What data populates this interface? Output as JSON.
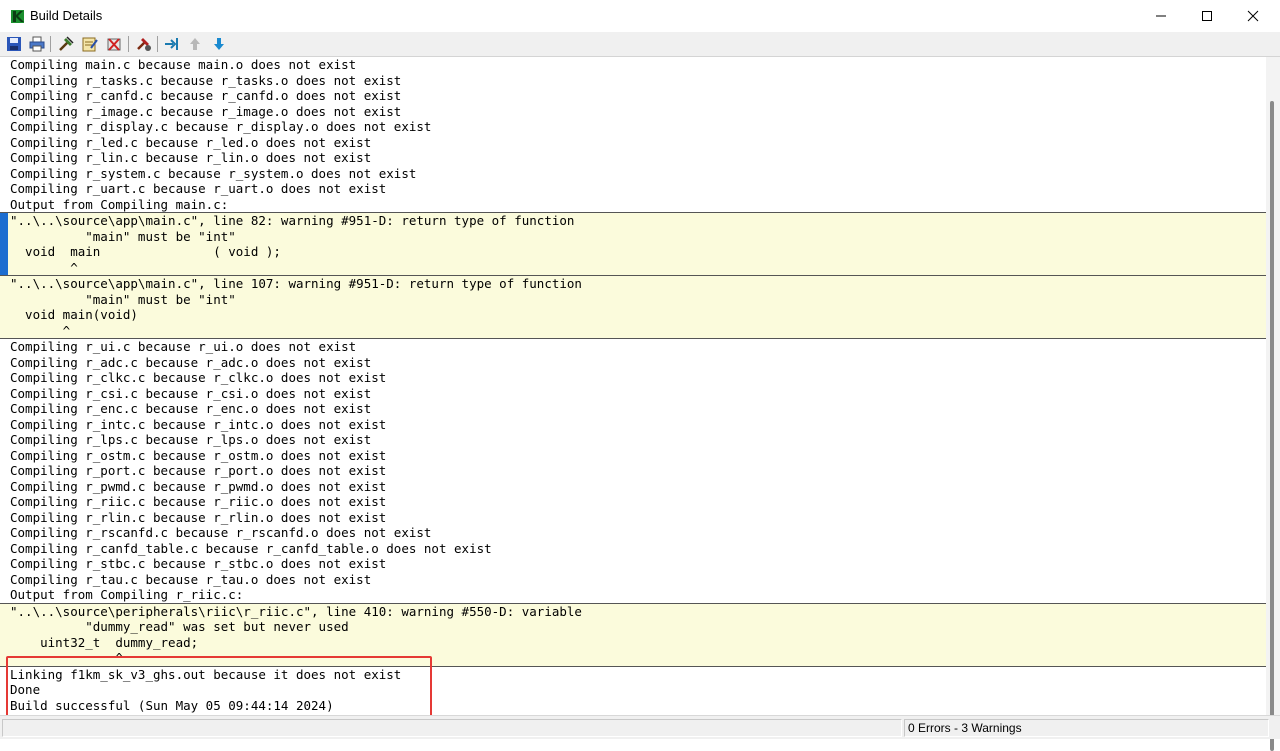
{
  "window": {
    "title": "Build Details"
  },
  "toolbar": {
    "buttons": [
      "save-icon",
      "print-icon",
      "build-icon",
      "edit-icon",
      "clean-icon",
      "settings-icon",
      "goto-icon",
      "prev-error-icon",
      "next-error-icon"
    ]
  },
  "log": {
    "group1": [
      "Compiling main.c because main.o does not exist",
      "Compiling r_tasks.c because r_tasks.o does not exist",
      "Compiling r_canfd.c because r_canfd.o does not exist",
      "Compiling r_image.c because r_image.o does not exist",
      "Compiling r_display.c because r_display.o does not exist",
      "Compiling r_led.c because r_led.o does not exist",
      "Compiling r_lin.c because r_lin.o does not exist",
      "Compiling r_system.c because r_system.o does not exist",
      "Compiling r_uart.c because r_uart.o does not exist",
      "Output from Compiling main.c:"
    ],
    "warning1": [
      "\"..\\..\\source\\app\\main.c\", line 82: warning #951-D: return type of function",
      "          \"main\" must be \"int\"",
      "  void  main               ( void );",
      "        ^"
    ],
    "warning2": [
      "\"..\\..\\source\\app\\main.c\", line 107: warning #951-D: return type of function",
      "          \"main\" must be \"int\"",
      "  void main(void)",
      "       ^"
    ],
    "group2": [
      "Compiling r_ui.c because r_ui.o does not exist",
      "Compiling r_adc.c because r_adc.o does not exist",
      "Compiling r_clkc.c because r_clkc.o does not exist",
      "Compiling r_csi.c because r_csi.o does not exist",
      "Compiling r_enc.c because r_enc.o does not exist",
      "Compiling r_intc.c because r_intc.o does not exist",
      "Compiling r_lps.c because r_lps.o does not exist",
      "Compiling r_ostm.c because r_ostm.o does not exist",
      "Compiling r_port.c because r_port.o does not exist",
      "Compiling r_pwmd.c because r_pwmd.o does not exist",
      "Compiling r_riic.c because r_riic.o does not exist",
      "Compiling r_rlin.c because r_rlin.o does not exist",
      "Compiling r_rscanfd.c because r_rscanfd.o does not exist",
      "Compiling r_canfd_table.c because r_canfd_table.o does not exist",
      "Compiling r_stbc.c because r_stbc.o does not exist",
      "Compiling r_tau.c because r_tau.o does not exist",
      "Output from Compiling r_riic.c:"
    ],
    "warning3": [
      "\"..\\..\\source\\peripherals\\riic\\r_riic.c\", line 410: warning #550-D: variable",
      "          \"dummy_read\" was set but never used",
      "    uint32_t  dummy_read;",
      "              ^"
    ],
    "group3": [
      "Linking f1km_sk_v3_ghs.out because it does not exist",
      "Done",
      "Build successful (Sun May 05 09:44:14 2024)"
    ]
  },
  "status": {
    "summary": "0 Errors - 3 Warnings"
  }
}
